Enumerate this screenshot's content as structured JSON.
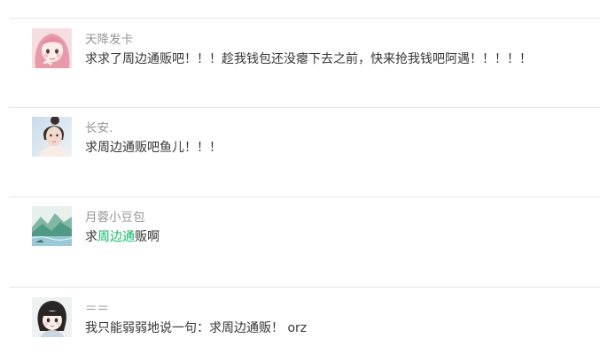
{
  "comments": [
    {
      "nickname": "天降发卡",
      "content": "求求了周边通贩吧！！！趁我钱包还没瘪下去之前，快来抢我钱吧阿遇！！！！！",
      "avatar_icon": "anime-girl-pink-hair-avatar"
    },
    {
      "nickname": "长安.",
      "content": "求周边通贩吧鱼儿！！！",
      "avatar_icon": "girl-photo-avatar"
    },
    {
      "nickname": "月蓉小豆包",
      "content_before": "求",
      "content_link": "周边通",
      "content_after": "贩啊",
      "avatar_icon": "landscape-painting-avatar"
    },
    {
      "nickname": "＝＝",
      "content": "我只能弱弱地说一句：求周边通贩！ orz",
      "avatar_icon": "chibi-girl-black-hair-avatar"
    }
  ],
  "colors": {
    "nickname": "#959595",
    "content": "#353535",
    "link": "#07c160",
    "divider": "#e8e8e8"
  }
}
